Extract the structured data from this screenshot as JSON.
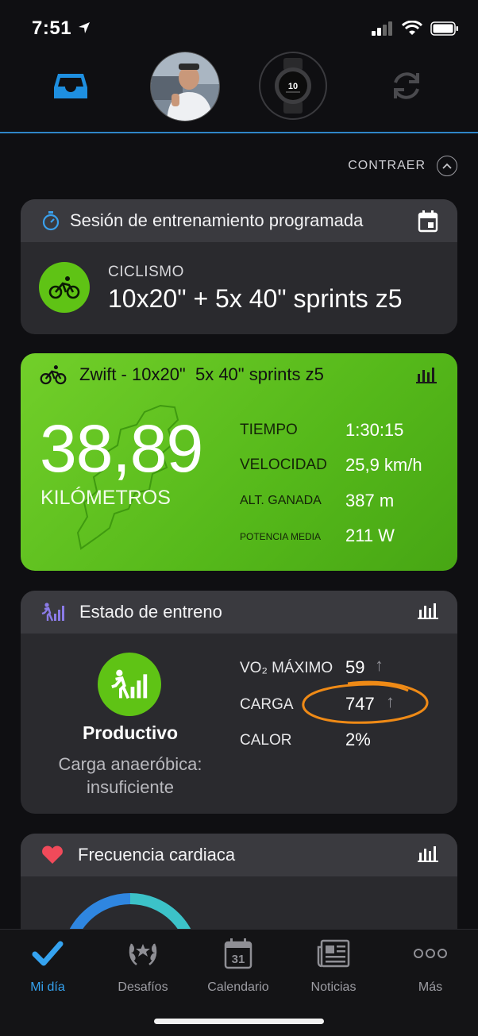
{
  "status_bar": {
    "time": "7:51"
  },
  "top_nav": {
    "items": [
      {
        "icon": "inbox-icon"
      },
      {
        "icon": "avatar"
      },
      {
        "icon": "watch-icon"
      },
      {
        "icon": "sync-icon"
      }
    ],
    "accent": "#2f86c8"
  },
  "collapse": {
    "label": "CONTRAER"
  },
  "scheduled_workout": {
    "header": "Sesión de entrenamiento programada",
    "sport": "CICLISMO",
    "name": "10x20\" + 5x 40\" sprints z5"
  },
  "activity": {
    "title": "Zwift - 10x20\"  5x 40\" sprints z5",
    "distance": "38,89",
    "unit": "KILÓMETROS",
    "stats": [
      {
        "label": "TIEMPO",
        "value": "1:30:15"
      },
      {
        "label": "VELOCIDAD",
        "value": "25,9 km/h"
      },
      {
        "label": "ALT. GANADA",
        "value": "387 m"
      },
      {
        "label": "POTENCIA MEDIA",
        "value": "211 W"
      }
    ],
    "color": "#5fc315"
  },
  "training_status": {
    "header": "Estado de entreno",
    "status": "Productivo",
    "sub1": "Carga anaeróbica:",
    "sub2": "insuficiente",
    "metrics": [
      {
        "label": "VO₂ MÁXIMO",
        "value": "59",
        "trend": "↑"
      },
      {
        "label": "CARGA",
        "value": "747",
        "trend": "↑"
      },
      {
        "label": "CALOR",
        "value": "2%"
      }
    ]
  },
  "heart_rate": {
    "header": "Frecuencia cardiaca"
  },
  "tabbar": {
    "tabs": [
      {
        "label": "Mi día",
        "icon": "check-icon",
        "active": true
      },
      {
        "label": "Desafíos",
        "icon": "laurel-icon"
      },
      {
        "label": "Calendario",
        "icon": "calendar-icon",
        "day": "31"
      },
      {
        "label": "Noticias",
        "icon": "news-icon"
      },
      {
        "label": "Más",
        "icon": "more-icon"
      }
    ],
    "active_color": "#35a3f0"
  }
}
